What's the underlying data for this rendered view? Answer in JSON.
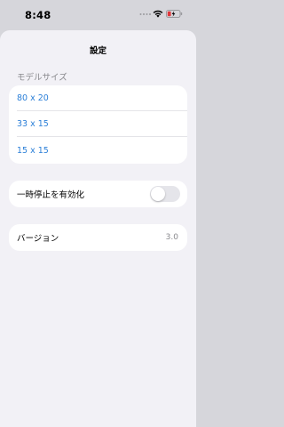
{
  "status_bar": {
    "time": "8:48",
    "signal_icon": "cellular-dots-icon",
    "wifi_icon": "wifi-icon",
    "battery_icon": "battery-charging-low-icon",
    "battery_color": "#e0373b"
  },
  "sheet": {
    "title": "設定"
  },
  "model_size": {
    "header": "モデルサイズ",
    "options": [
      {
        "label": "80 x 20"
      },
      {
        "label": "33 x 15"
      },
      {
        "label": "15 x 15"
      }
    ]
  },
  "pause": {
    "label": "一時停止を有効化",
    "enabled": false
  },
  "version": {
    "label": "バージョン",
    "value": "3.0"
  },
  "colors": {
    "accent": "#2b7fd8",
    "background": "#f2f1f6",
    "secondary_text": "#8a8a8e"
  }
}
